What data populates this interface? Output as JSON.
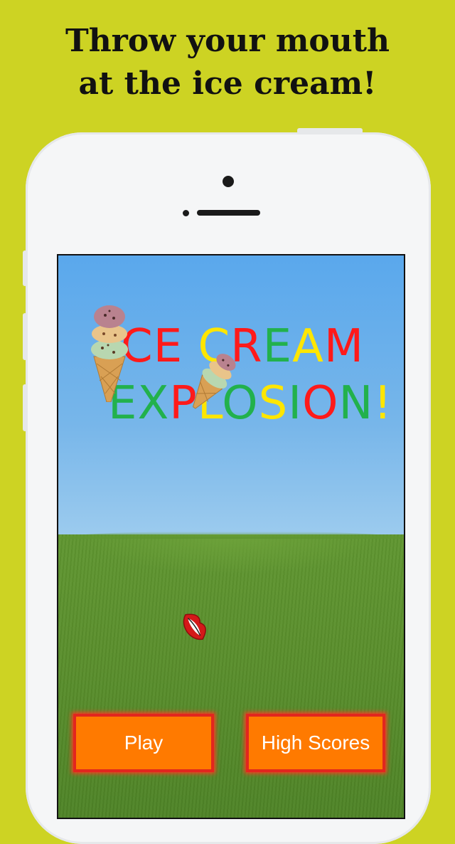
{
  "headline": {
    "line1": "Throw your mouth",
    "line2": "at the ice cream!"
  },
  "game": {
    "title_line1": [
      {
        "text": "CE ",
        "color": "#ff1a1a"
      },
      {
        "text": "C",
        "color": "#ffe600"
      },
      {
        "text": "R",
        "color": "#ff1a1a"
      },
      {
        "text": "E",
        "color": "#22b14c"
      },
      {
        "text": "A",
        "color": "#ffe600"
      },
      {
        "text": "M",
        "color": "#ff1a1a"
      }
    ],
    "title_line2": [
      {
        "text": "EX",
        "color": "#22b14c"
      },
      {
        "text": "P",
        "color": "#ff1a1a"
      },
      {
        "text": "L",
        "color": "#ffe600"
      },
      {
        "text": "O",
        "color": "#22b14c"
      },
      {
        "text": "S",
        "color": "#ffe600"
      },
      {
        "text": "I",
        "color": "#22b14c"
      },
      {
        "text": "O",
        "color": "#ff1a1a"
      },
      {
        "text": "N",
        "color": "#22b14c"
      },
      {
        "text": "!",
        "color": "#ffe600"
      }
    ],
    "buttons": {
      "play": "Play",
      "high_scores": "High Scores"
    }
  },
  "colors": {
    "background": "#cdd323",
    "button_fill": "#ff7a00",
    "button_border": "#e2261e"
  },
  "icons": {
    "cone_large": "ice-cream-cone-icon",
    "cone_small": "ice-cream-cone-icon",
    "mouth": "lips-icon"
  }
}
